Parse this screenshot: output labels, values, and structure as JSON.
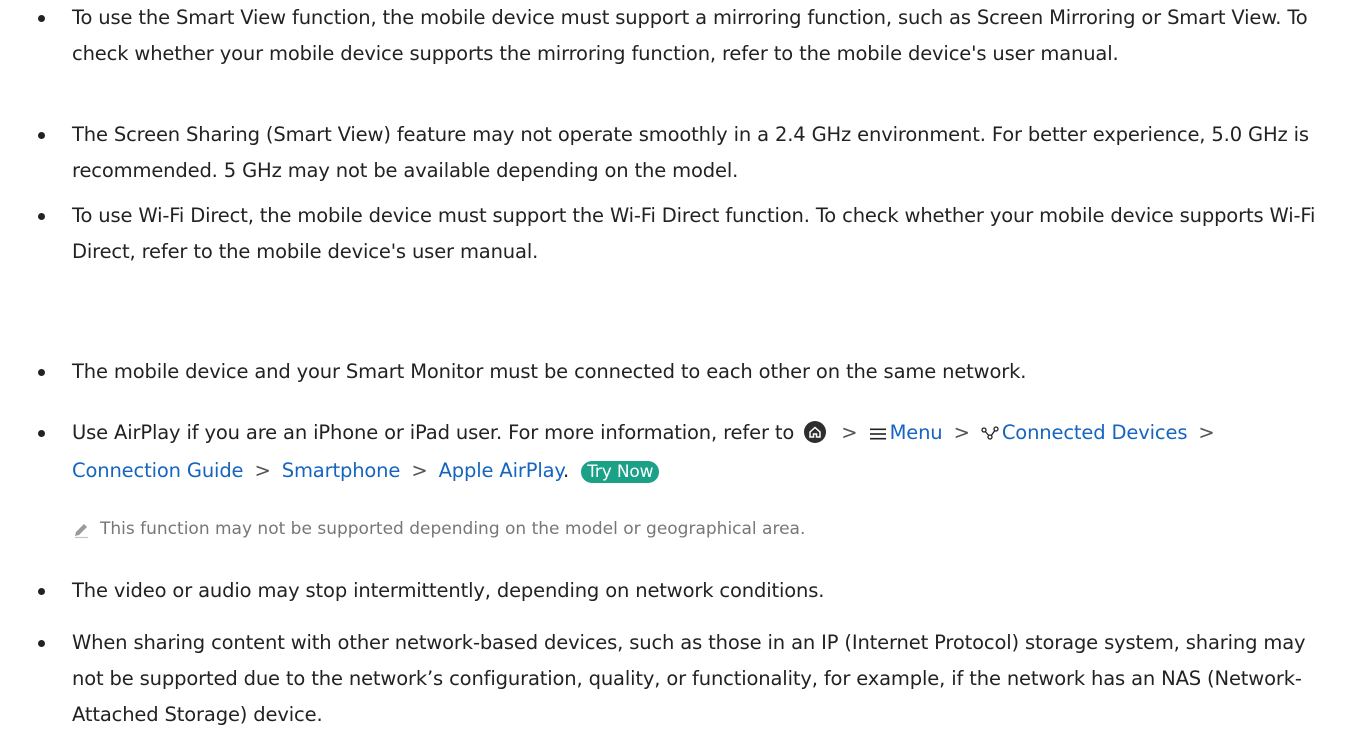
{
  "bullets": [
    "To use the Smart View function, the mobile device must support a mirroring function, such as Screen Mirroring or Smart View. To check whether your mobile device supports the mirroring function, refer to the mobile device's user manual.",
    "The Screen Sharing (Smart View) feature may not operate smoothly in a 2.4 GHz environment. For better experience, 5.0 GHz is recommended. 5 GHz may not be available depending on the model.",
    "To use Wi-Fi Direct, the mobile device must support the Wi-Fi Direct function. To check whether your mobile device supports Wi-Fi Direct, refer to the mobile device's user manual.",
    "The mobile device and your Smart Monitor must be connected to each other on the same network."
  ],
  "airplay": {
    "intro": "Use AirPlay if you are an iPhone or iPad user. For more information, refer to",
    "path": [
      "Menu",
      "Connected Devices",
      "Connection Guide",
      "Smartphone",
      "Apple AirPlay"
    ],
    "separator": ">",
    "end": ".",
    "try_now": "Try Now",
    "icons": [
      "home-icon",
      "menu-icon",
      "connected-devices-icon"
    ]
  },
  "note": {
    "icon": "pencil-icon",
    "text": "This function may not be supported depending on the model or geographical area."
  },
  "bullets_after": [
    "The video or audio may stop intermittently, depending on network conditions.",
    "When sharing content with other network-based devices, such as those in an IP (Internet Protocol) storage system, sharing may not be supported due to the network’s configuration, quality, or functionality, for example, if the network has an NAS (Network-Attached Storage) device."
  ],
  "colors": {
    "link": "#1565c0",
    "try_now_bg": "#1aa187",
    "text": "#222222",
    "note": "#777777"
  }
}
